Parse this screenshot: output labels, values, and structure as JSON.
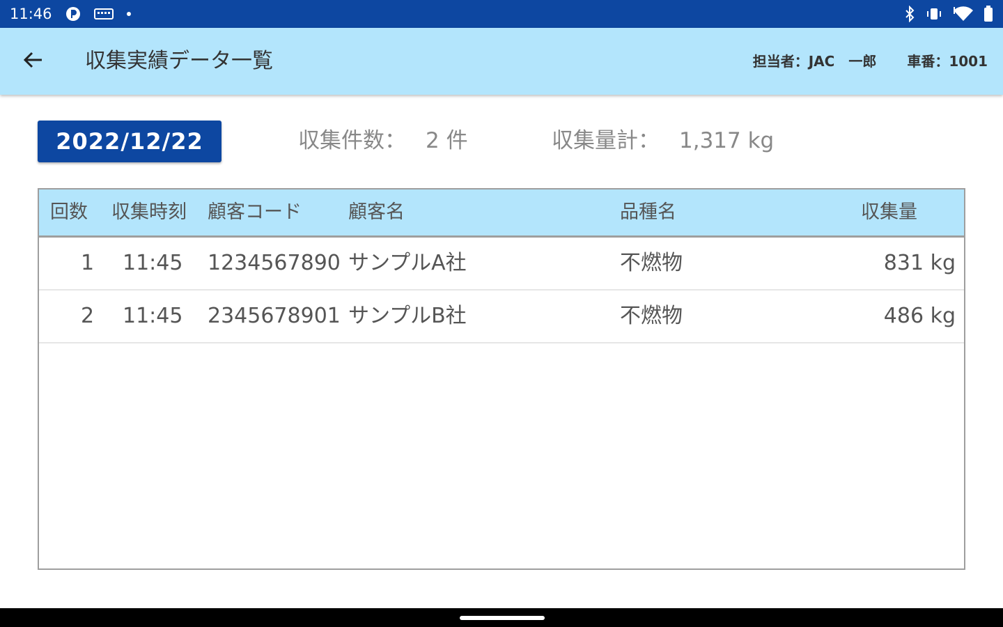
{
  "status_bar": {
    "time": "11:46",
    "left_icons": [
      "p-icon",
      "keyboard-icon",
      "dot-icon"
    ],
    "right_icons": [
      "bluetooth-icon",
      "vibrate-icon",
      "wifi-icon",
      "battery-icon"
    ]
  },
  "app_bar": {
    "title": "収集実績データ一覧",
    "staff_label": "担当者：",
    "staff_value": "JAC　一郎",
    "vehicle_label": "車番：",
    "vehicle_value": "1001"
  },
  "summary": {
    "date": "2022/12/22",
    "count_label": "収集件数：",
    "count_value": "2 件",
    "total_label": "収集量計：",
    "total_value": "1,317 kg"
  },
  "table": {
    "headers": {
      "round": "回数",
      "time": "収集時刻",
      "customer_code": "顧客コード",
      "customer_name": "顧客名",
      "item_name": "品種名",
      "amount": "収集量"
    },
    "rows": [
      {
        "round": "1",
        "time": "11:45",
        "customer_code": "1234567890",
        "customer_name": "サンプルA社",
        "item_name": "不燃物",
        "amount": "831 kg"
      },
      {
        "round": "2",
        "time": "11:45",
        "customer_code": "2345678901",
        "customer_name": "サンプルB社",
        "item_name": "不燃物",
        "amount": "486 kg"
      }
    ]
  },
  "colors": {
    "status_bar": "#0d47a1",
    "app_bar": "#b3e5fc",
    "date_button": "#0d47a1",
    "table_header": "#b3e5fc"
  }
}
